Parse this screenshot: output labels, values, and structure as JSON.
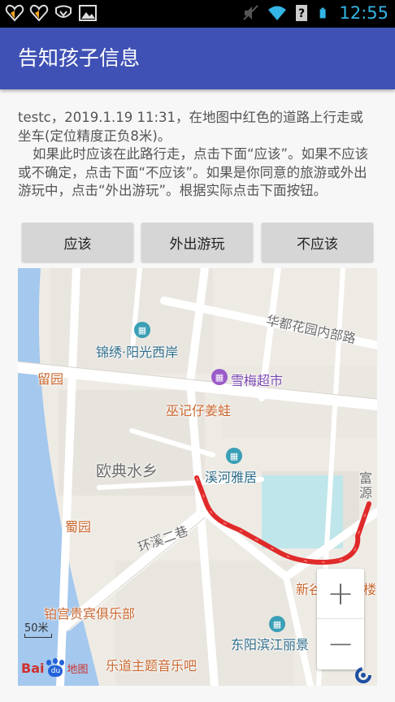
{
  "status_bar": {
    "time": "12:55",
    "icons": [
      "heart-icon",
      "heart-icon",
      "shield-icon",
      "image-icon",
      "mute-icon",
      "wifi-icon",
      "signal-unknown-icon",
      "battery-icon"
    ]
  },
  "app_bar": {
    "title": "告知孩子信息"
  },
  "message": {
    "line1": "testc，2019.1.19 11:31，在地图中红色的道路上行走或坐车(定位精度正负8米)。",
    "line2": "如果此时应该在此路行走，点击下面“应该”。如果不应该或不确定，点击下面“不应该”。如果是你同意的旅游或外出游玩中，点击“外出游玩”。根据实际点击下面按钮。"
  },
  "buttons": {
    "should": "应该",
    "outing": "外出游玩",
    "should_not": "不应该"
  },
  "map": {
    "labels": {
      "huadu": "华都花园内部路",
      "jinxiu": "锦绣·阳光西岸",
      "liuyuan": "留园",
      "xuemei": "雪梅超市",
      "wuji": "巫记仔姜蛙",
      "oudian": "欧典水乡",
      "xihe": "溪河雅居",
      "fuyuan": "富源",
      "shuyuan": "蜀园",
      "huanxi": "环溪二巷",
      "xingu": "新谷",
      "lou": "楼",
      "bogong": "铂宫贵宾俱乐部",
      "dongyang": "东阳滨江丽景",
      "ledao": "乐道主题音乐吧"
    },
    "scale_label": "50米",
    "zoom_in": "+",
    "zoom_out": "−",
    "logo_bai": "Bai",
    "logo_du": "du",
    "logo_map": "地图",
    "route_color": "#e02a2a",
    "river_color": "#a4c8ee"
  }
}
